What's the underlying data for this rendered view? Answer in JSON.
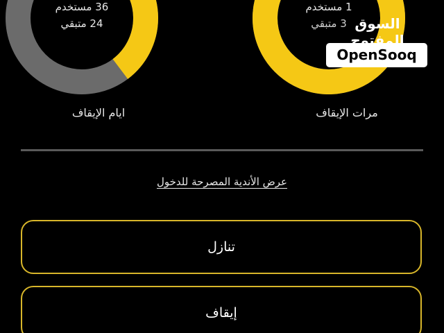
{
  "colors": {
    "background": "#000000",
    "accent": "#f5c815",
    "track": "#6b6b6b",
    "button_border": "#d8b62a",
    "divider": "#5a5a5a"
  },
  "stats": {
    "pause_days": {
      "caption": "ايام الإيقاف",
      "used_text": "36 مستخدم",
      "remaining_text": "24 متبقي",
      "used": 36,
      "remaining": 24,
      "highlight_fraction": 0.3
    },
    "pause_times": {
      "caption": "مرات الإيقاف",
      "used_text": "1 مستخدم",
      "remaining_text": "3 متبقي",
      "used": 1,
      "remaining": 3,
      "highlight_fraction": 0.88
    }
  },
  "links": {
    "allowed_clubs": "عرض الأندية المصرحة للدخول"
  },
  "buttons": {
    "withdraw": "تنازل",
    "pause": "إيقاف"
  },
  "brand": {
    "arabic": "السوق المفتوح",
    "english": "OpenSooq"
  }
}
